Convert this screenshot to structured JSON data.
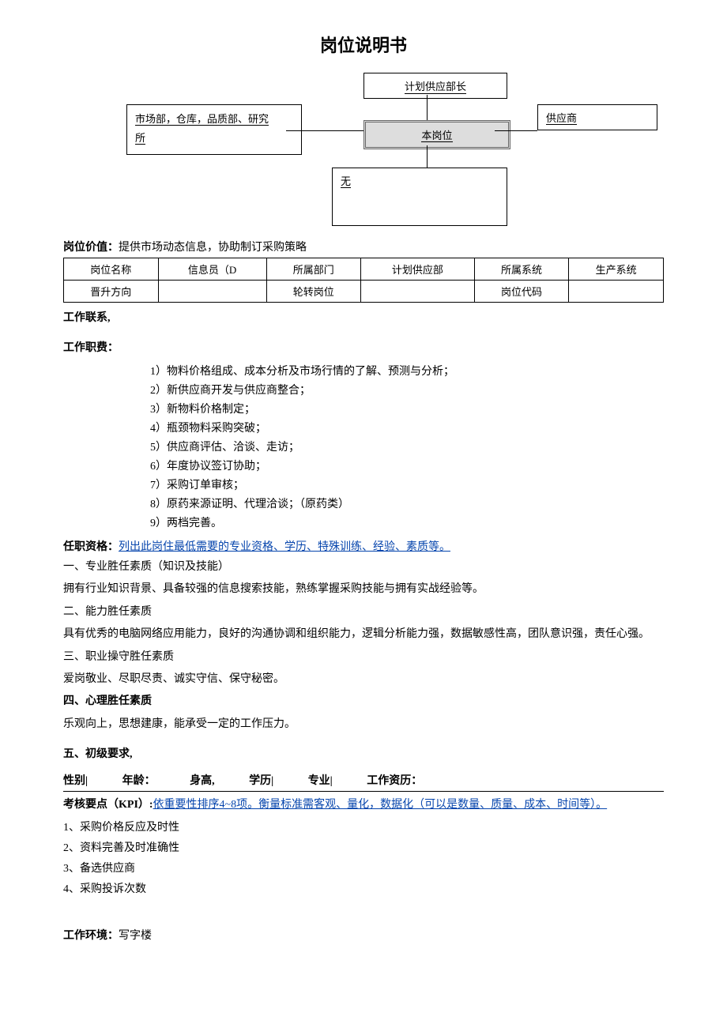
{
  "title": "岗位说明书",
  "org": {
    "top": "计划供应部长",
    "left_line1": "市场部，仓库，品质部、研究",
    "left_line2": "所",
    "center": "本岗位",
    "right": "供应商",
    "bottom": "无"
  },
  "value_label": "岗位价值：",
  "value_text": "提供市场动态信息，协助制订采购策略",
  "info_table": {
    "r1c1": "岗位名称",
    "r1c2": "信息员（D",
    "r1c3": "所属部门",
    "r1c4": "计划供应部",
    "r1c5": "所属系统",
    "r1c6": "生产系统",
    "r2c1": "晋升方向",
    "r2c2": "",
    "r2c3": "轮转岗位",
    "r2c4": "",
    "r2c5": "岗位代码",
    "r2c6": ""
  },
  "work_contact": "工作联系,",
  "duties_label": "工作职费：",
  "duties": [
    "1）物料价格组成、成本分析及市场行情的了解、预测与分析；",
    "2）新供应商开发与供应商整合；",
    "3）新物料价格制定；",
    "4）瓶颈物料采购突破；",
    "5）供应商评估、洽谈、走访；",
    "6）年度协议签订协助；",
    "7）采购订单审核；",
    "8）原药来源证明、代理洽谈；（原药类）",
    "9）两档完善。"
  ],
  "qual_label": "任职资格：",
  "qual_link": "列出此岗住最低需要的专业资格、学历、特殊训练、经验、素质等。",
  "q1_title": "一、专业胜任素质（知识及技能）",
  "q1_text": "拥有行业知识背景、具备较强的信息搜索技能，熟练掌握采购技能与拥有实战经验等。",
  "q2_title": "二、能力胜任素质",
  "q2_text": "具有优秀的电脑网络应用能力，良好的沟通协调和组织能力，逻辑分析能力强，数据敏感性高，团队意识强，责任心强。",
  "q3_title": "三、职业操守胜任素质",
  "q3_text": "爱岗敬业、尽职尽责、诚实守信、保守秘密。",
  "q4_title": "四、心理胜任素质",
  "q4_text": "乐观向上，思想建康，能承受一定的工作压力。",
  "q5_title": "五、初级要求,",
  "req": {
    "gender": "性别|",
    "age": "年龄：",
    "height": "身高,",
    "edu": "学历|",
    "major": "专业|",
    "exp": "工作资历："
  },
  "kpi_label": "考核要点（KPI）:",
  "kpi_link": "依重要性排序4~8项。衡量标准需客观、量化，数据化（可以是数量、质量、成本、时间等）。",
  "kpi": [
    "1、采购价格反应及时性",
    "2、资料完善及时准确性",
    "3、备选供应商",
    "4、采购投诉次数"
  ],
  "env_label": "工作环境：",
  "env_text": "写字楼"
}
